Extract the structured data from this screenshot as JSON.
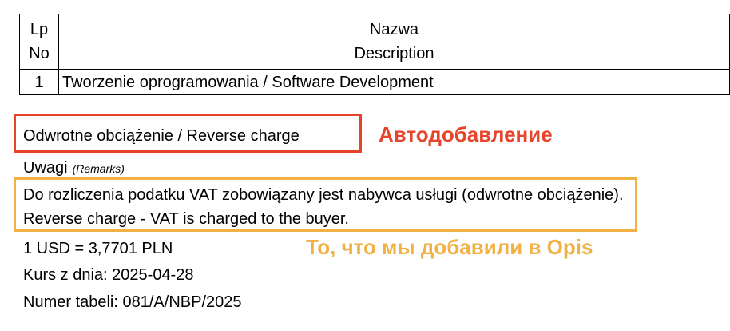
{
  "table": {
    "header": {
      "lp_pl": "Lp",
      "lp_en": "No",
      "name_pl": "Nazwa",
      "name_en": "Description"
    },
    "rows": [
      {
        "lp": "1",
        "name": "Tworzenie oprogramowania / Software Development"
      }
    ]
  },
  "reverse_charge": {
    "text": "Odwrotne obciążenie / Reverse charge",
    "annotation": "Автодобавление",
    "annotation_color": "#e5452c"
  },
  "remarks": {
    "label": "Uwagi",
    "label_en": "(Remarks)",
    "text": "Do rozliczenia podatku VAT zobowiązany jest nabywca usługi (odwrotne obciążenie). Reverse charge - VAT is charged to the buyer.",
    "annotation": "То, что мы добавили в Opis",
    "annotation_color": "#f1b145"
  },
  "exchange": {
    "rate": "1 USD = 3,7701 PLN",
    "date": "Kurs z dnia: 2025-04-28",
    "table_no": "Numer tabeli: 081/A/NBP/2025"
  }
}
